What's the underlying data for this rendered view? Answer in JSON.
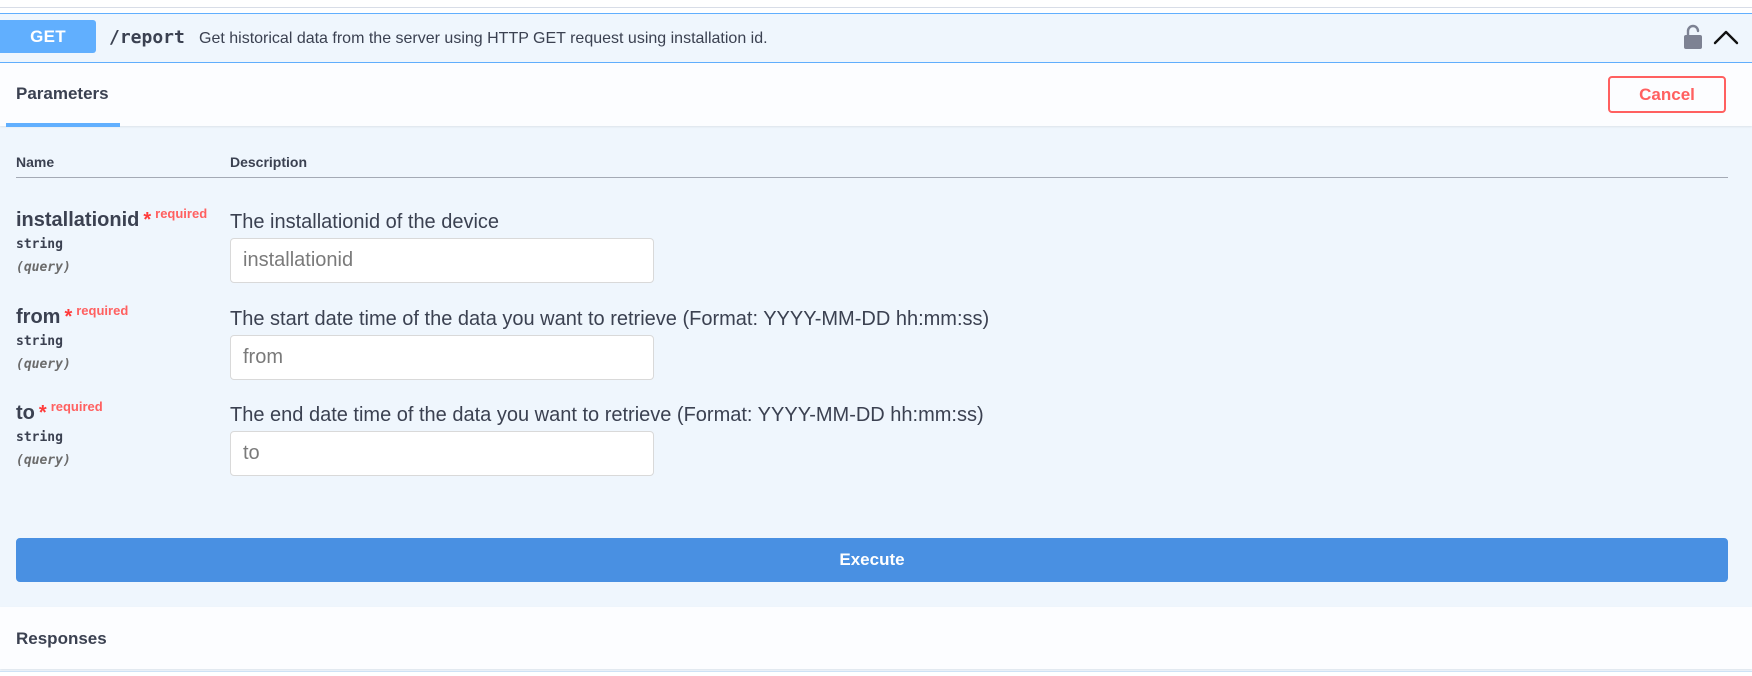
{
  "operation": {
    "method": "GET",
    "path": "/report",
    "description": "Get historical data from the server using HTTP GET request using installation id."
  },
  "icons": {
    "lock": "unlocked-padlock-icon",
    "chevron": "chevron-up-icon"
  },
  "tabs": {
    "parameters_label": "Parameters"
  },
  "actions": {
    "cancel_label": "Cancel",
    "execute_label": "Execute"
  },
  "table": {
    "name_header": "Name",
    "description_header": "Description"
  },
  "parameters": [
    {
      "name": "installationid",
      "required_star": "*",
      "required_label": "required",
      "type": "string",
      "in": "(query)",
      "description": "The installationid of the device",
      "placeholder": "installationid"
    },
    {
      "name": "from",
      "required_star": "*",
      "required_label": "required",
      "type": "string",
      "in": "(query)",
      "description": "The start date time of the data you want to retrieve (Format: YYYY-MM-DD hh:mm:ss)",
      "placeholder": "from"
    },
    {
      "name": "to",
      "required_star": "*",
      "required_label": "required",
      "type": "string",
      "in": "(query)",
      "description": "The end date time of the data you want to retrieve (Format: YYYY-MM-DD hh:mm:ss)",
      "placeholder": "to"
    }
  ],
  "responses": {
    "title": "Responses"
  },
  "colors": {
    "method_get": "#61affe",
    "execute": "#4990e2",
    "cancel": "#ff6060",
    "required": "#ff3b3b",
    "text": "#3b4151",
    "block_background": "#eff6fd"
  }
}
